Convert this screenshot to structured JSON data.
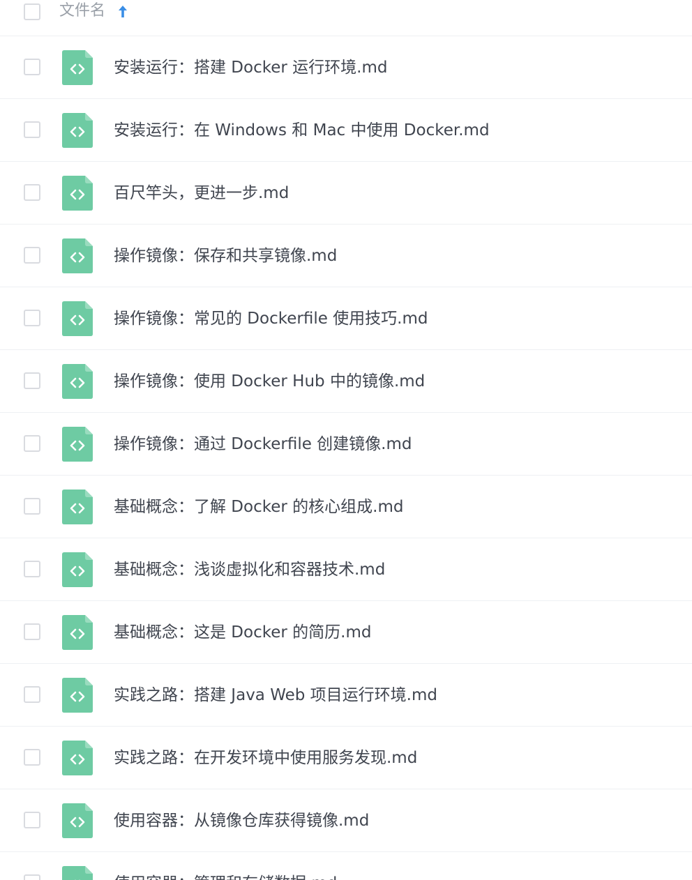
{
  "header": {
    "column_label": "文件名",
    "sort_icon": "arrow-up-icon",
    "sort_direction": "ascending"
  },
  "colors": {
    "icon_green": "#6ecba3",
    "sort_blue": "#3a8ee6",
    "text": "#40454f",
    "header_text": "#9aa0a8",
    "checkbox_border": "#d9dbe0",
    "divider": "#eef0f3"
  },
  "files": [
    {
      "name": "安装运行：搭建 Docker 运行环境.md",
      "icon": "code-file-icon"
    },
    {
      "name": "安装运行：在 Windows 和 Mac 中使用 Docker.md",
      "icon": "code-file-icon"
    },
    {
      "name": "百尺竿头，更进一步.md",
      "icon": "code-file-icon"
    },
    {
      "name": "操作镜像：保存和共享镜像.md",
      "icon": "code-file-icon"
    },
    {
      "name": "操作镜像：常见的 Dockerfile 使用技巧.md",
      "icon": "code-file-icon"
    },
    {
      "name": "操作镜像：使用 Docker Hub 中的镜像.md",
      "icon": "code-file-icon"
    },
    {
      "name": "操作镜像：通过 Dockerfile 创建镜像.md",
      "icon": "code-file-icon"
    },
    {
      "name": "基础概念：了解 Docker 的核心组成.md",
      "icon": "code-file-icon"
    },
    {
      "name": "基础概念：浅谈虚拟化和容器技术.md",
      "icon": "code-file-icon"
    },
    {
      "name": "基础概念：这是 Docker 的简历.md",
      "icon": "code-file-icon"
    },
    {
      "name": "实践之路：搭建 Java Web 项目运行环境.md",
      "icon": "code-file-icon"
    },
    {
      "name": "实践之路：在开发环境中使用服务发现.md",
      "icon": "code-file-icon"
    },
    {
      "name": "使用容器：从镜像仓库获得镜像.md",
      "icon": "code-file-icon"
    },
    {
      "name": "使用容器：管理和存储数据.md",
      "icon": "code-file-icon"
    }
  ]
}
